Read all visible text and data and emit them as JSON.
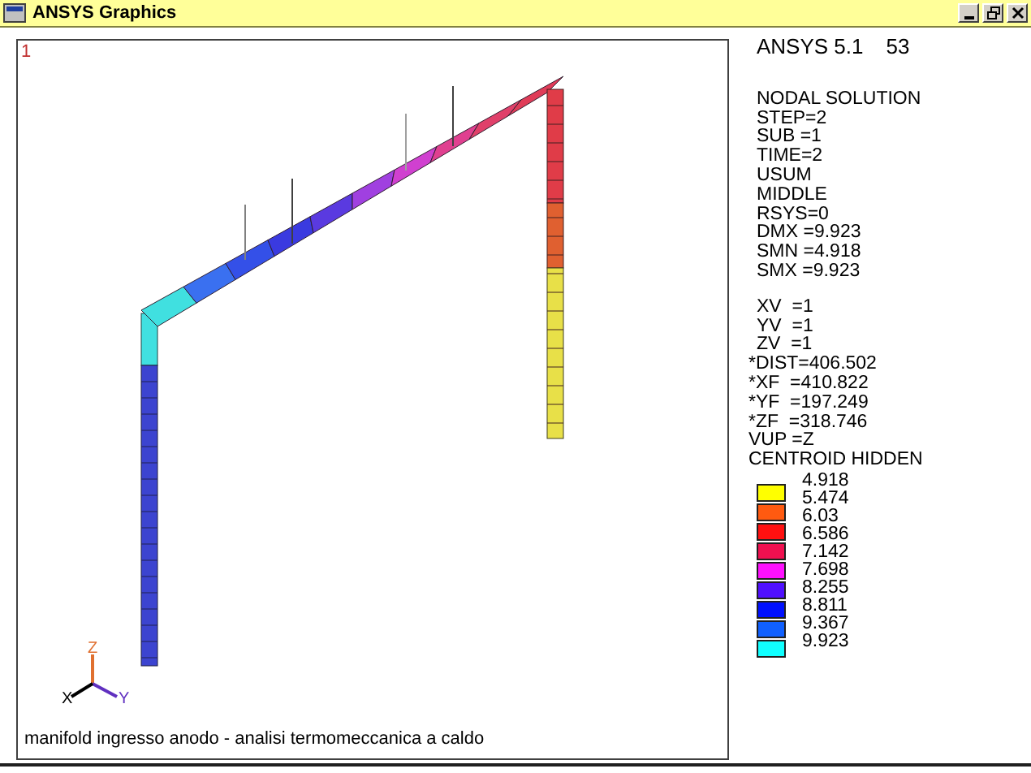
{
  "window": {
    "title": "ANSYS Graphics"
  },
  "viewport": {
    "window_number": "1",
    "caption": "manifold ingresso anodo - analisi termomeccanica a caldo",
    "triad": [
      "X",
      "Y",
      "Z"
    ]
  },
  "info": {
    "program": "ANSYS 5.1",
    "plot_number": "53",
    "solution": [
      "NODAL SOLUTION",
      "STEP=2",
      "SUB =1",
      "TIME=2",
      "USUM",
      "MIDDLE",
      "RSYS=0",
      "DMX =9.923",
      "SMN =4.918",
      "SMX =9.923"
    ],
    "view": [
      "XV  =1",
      "YV  =1",
      "ZV  =1",
      "*DIST=406.502",
      "*XF  =410.822",
      "*YF  =197.249",
      "*ZF  =318.746",
      "VUP =Z",
      "CENTROID HIDDEN"
    ]
  },
  "legend": {
    "bands": [
      {
        "color": "#ffff00"
      },
      {
        "color": "#ff5a10"
      },
      {
        "color": "#ff1010"
      },
      {
        "color": "#f01050"
      },
      {
        "color": "#ff10ff"
      },
      {
        "color": "#5010ff"
      },
      {
        "color": "#0010ff"
      },
      {
        "color": "#1060ff"
      },
      {
        "color": "#10ffff"
      }
    ],
    "values": [
      "4.918",
      "5.474",
      "6.03",
      "6.586",
      "7.142",
      "7.698",
      "8.255",
      "8.811",
      "9.367",
      "9.923"
    ]
  }
}
